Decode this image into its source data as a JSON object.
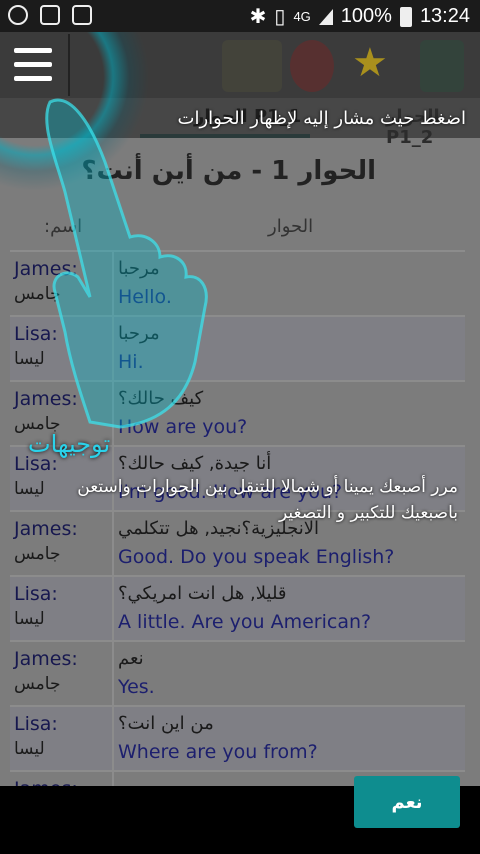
{
  "status_bar": {
    "signal_type": "4G",
    "battery": "100%",
    "time": "13:24"
  },
  "tabs": [
    {
      "label": "الحوار P1_1",
      "active": true
    },
    {
      "label": "الحوار P1_2",
      "active": false
    }
  ],
  "dialogue": {
    "title": "الحوار 1 - من أين أنت؟",
    "columns": {
      "name": ":اسم",
      "dialogue": "الحوار"
    },
    "rows": [
      {
        "speaker_en": "James:",
        "speaker_ar": "جامس",
        "line_ar": "مرحبا",
        "line_en": "Hello."
      },
      {
        "speaker_en": "Lisa:",
        "speaker_ar": "ليسا",
        "line_ar": "مرحبا",
        "line_en": "Hi."
      },
      {
        "speaker_en": "James:",
        "speaker_ar": "جامس",
        "line_ar": "كيف حالك؟",
        "line_en": "How are you?"
      },
      {
        "speaker_en": "Lisa:",
        "speaker_ar": "ليسا",
        "line_ar": "أنا جيدة, كيف حالك؟",
        "line_en": "I'm good. How are you?"
      },
      {
        "speaker_en": "James:",
        "speaker_ar": "جامس",
        "line_ar": "الانجليزية؟نجيد, هل تتكلمي",
        "line_en": "Good. Do you speak English?"
      },
      {
        "speaker_en": "Lisa:",
        "speaker_ar": "ليسا",
        "line_ar": "قليلا, هل انت امريكي؟",
        "line_en": "A little. Are you American?"
      },
      {
        "speaker_en": "James:",
        "speaker_ar": "جامس",
        "line_ar": "نعم",
        "line_en": "Yes."
      },
      {
        "speaker_en": "Lisa:",
        "speaker_ar": "ليسا",
        "line_ar": "من اين انت؟",
        "line_en": "Where are you from?"
      },
      {
        "speaker_en": "James:",
        "speaker_ar": "",
        "line_ar": "",
        "line_en": ""
      }
    ]
  },
  "tutorial": {
    "tip_top": "اضغط حيث مشار إليه لإظهار الحوارات",
    "heading": "توجيهات",
    "body": "مرر أصبعك يمينا أو شمالا للتنقل بين الحوارات واستعن باصبعيك للتكبير و التصغير",
    "ok_label": "نعم"
  }
}
